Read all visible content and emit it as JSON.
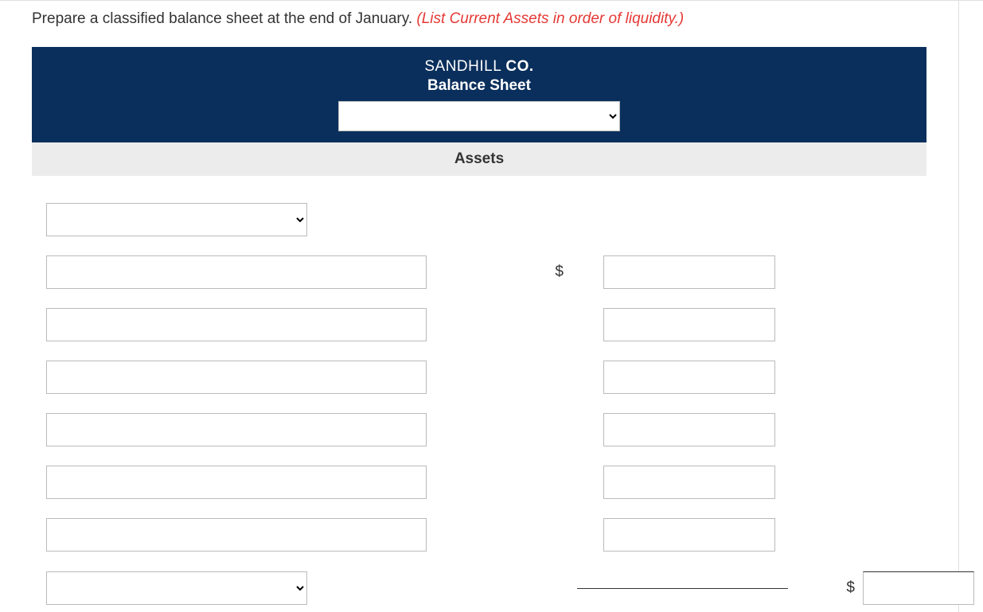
{
  "instruction": {
    "main": "Prepare a classified balance sheet at the end of January. ",
    "hint": "(List Current Assets in order of liquidity.)"
  },
  "header": {
    "company_pre": "SANDHILL ",
    "company_bold": "CO.",
    "title": "Balance Sheet",
    "date_value": ""
  },
  "section": "Assets",
  "currency": "$",
  "rows": {
    "category1": "",
    "item1_label": "",
    "item1_value": "",
    "item2_label": "",
    "item2_value": "",
    "item3_label": "",
    "item3_value": "",
    "item4_label": "",
    "item4_value": "",
    "item5_label": "",
    "item5_value": "",
    "item6_label": "",
    "item6_value": "",
    "category2": "",
    "total_value": ""
  }
}
